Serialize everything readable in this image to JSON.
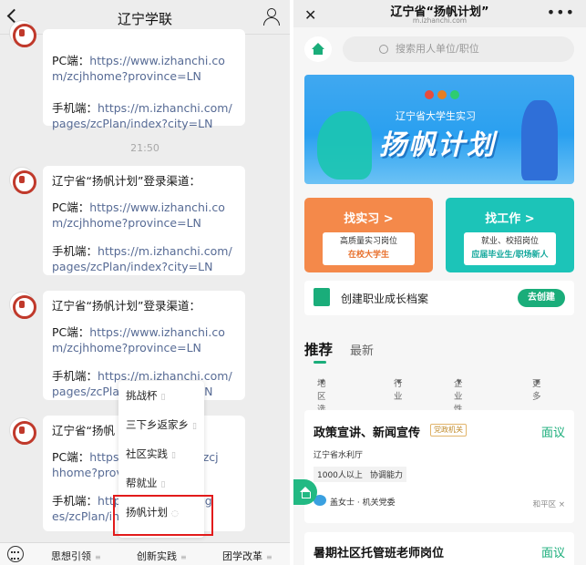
{
  "left": {
    "title": "辽宁学联",
    "messages": [
      {
        "line1": "",
        "pc_label": "PC端：",
        "pc_url": "https://www.izhanchi.com/zcjhhome?province=LN",
        "mobile_label": "手机端：",
        "mobile_url": "https://m.izhanchi.com/pages/zcPlan/index?city=LN"
      },
      {
        "line1": "辽宁省“扬帆计划”登录渠道：",
        "pc_label": "PC端：",
        "pc_url": "https://www.izhanchi.com/zcjhhome?province=LN",
        "mobile_label": "手机端：",
        "mobile_url": "https://m.izhanchi.com/pages/zcPlan/index?city=LN"
      },
      {
        "line1": "辽宁省“扬帆计划”登录渠道：",
        "pc_label": "PC端：",
        "pc_url": "https://www.izhanchi.com/zcjhhome?province=LN",
        "mobile_label": "手机端：",
        "mobile_url": "https://m.izhanchi.com/pages/zcPlan/index?city=LN"
      },
      {
        "line1": "辽宁省“扬帆计划”登录渠道：",
        "pc_label": "PC端：",
        "pc_url": "https://www.izhanchi.com/zcjhhome?province=LN",
        "mobile_label": "手机端：",
        "mobile_url": "https://m.izhanchi.com/pages/zcPlan/index?city=LN"
      }
    ],
    "msg0_mobile": "https://m.izhanchi.com/pages/zcPlan/index?city=LN",
    "msg2_pc_partial": "https://www.izhanchi.com/zcjhhome?province=LN",
    "msg2_mobile_partial": "https://m.izhanchi.com/pages/zcPlan/index?city=LN",
    "msg3_title_partial": "辽宁省“扬帆",
    "msg3_pc_partial": "https:",
    "msg3_pc_tail": "om/zcj",
    "msg3_pc_line2": "hhome?province=LN",
    "msg3_mobile_partial": "https",
    "msg3_mobile_tail": "pag",
    "msg3_mobile_line2": "es/zcPlan/index?city=LN",
    "time": "21:50",
    "menu": {
      "items": [
        "挑战杯",
        "三下乡返家乡",
        "社区实践",
        "帮就业",
        "扬帆计划"
      ]
    },
    "footer": {
      "item1": "思想引领",
      "item2": "创新实践",
      "item3": "团学改革"
    }
  },
  "right": {
    "title": "辽宁省“扬帆计划”",
    "subtitle": "m.izhanchi.com",
    "search_placeholder": "搜索用人单位/职位",
    "banner": {
      "sub": "辽宁省大学生实习",
      "big": "扬帆计划"
    },
    "card_intern": {
      "title": "找实习 >",
      "line1": "高质量实习岗位",
      "line2": "在校大学生"
    },
    "card_job": {
      "title": "找工作 >",
      "line1": "就业、校招岗位",
      "line2": "应届毕业生/职场新人"
    },
    "profile": {
      "text": "创建职业成长档案",
      "button": "去创建"
    },
    "tabs": {
      "recommend": "推荐",
      "latest": "最新"
    },
    "filters": {
      "f1": "地区选择",
      "f2": "行业",
      "f3": "企业性质",
      "f4": "更多"
    },
    "jobs": [
      {
        "title": "政策宣讲、新闻宣传",
        "tag": "党政机关",
        "pay": "面议",
        "company": "辽宁省水利厅",
        "tag1": "1000人以上",
        "tag2": "协调能力",
        "contact": "盖女士 · 机关党委",
        "location": "和平区 ×"
      },
      {
        "title": "暑期社区托管班老师岗位",
        "pay": "面议"
      }
    ],
    "colors": {
      "accent": "#1aad7a",
      "intern": "#f4894a",
      "job": "#1cc4b8"
    }
  }
}
